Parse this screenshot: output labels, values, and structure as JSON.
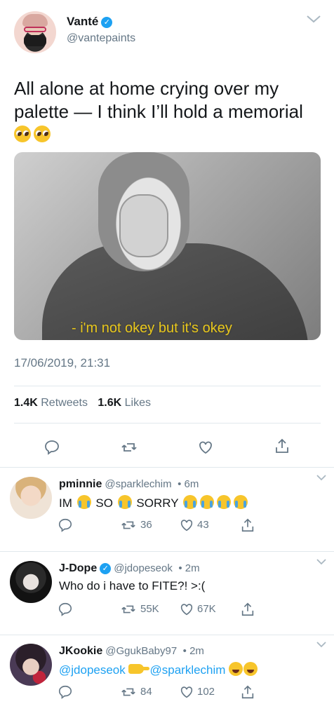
{
  "tweet": {
    "display_name": "Vanté",
    "handle": "@vantepaints",
    "text_line1": "All alone at home crying over my",
    "text_line2": "palette — I think I’ll hold a memorial",
    "media_caption": "- i'm not okey but it's okey",
    "timestamp": "17/06/2019, 21:31",
    "retweets_count": "1.4K",
    "retweets_label": "Retweets",
    "likes_count": "1.6K",
    "likes_label": "Likes",
    "icons": [
      "reply-icon",
      "retweet-icon",
      "like-icon",
      "share-icon",
      "chevron-down-icon",
      "verified-badge-icon"
    ]
  },
  "replies": [
    {
      "display_name": "pminnie",
      "handle": "@sparklechim",
      "time": "• 6m",
      "text_parts": [
        "IM",
        "SO",
        "SORRY"
      ],
      "retweets": "36",
      "likes": "43"
    },
    {
      "display_name": "J-Dope",
      "handle": "@jdopeseok",
      "time": "• 2m",
      "text": "Who do i have to FITE?! >:(",
      "retweets": "55K",
      "likes": "67K"
    },
    {
      "display_name": "JKookie",
      "handle": "@GgukBaby97",
      "time": "• 2m",
      "mention1": "@jdopeseok",
      "mention2": "@sparklechim",
      "retweets": "84",
      "likes": "102"
    }
  ],
  "colors": {
    "link": "#1da1f2",
    "secondary_text": "#657786",
    "primary_text": "#14171a",
    "divider": "#e1e8ed",
    "caption": "#e9c81c"
  }
}
